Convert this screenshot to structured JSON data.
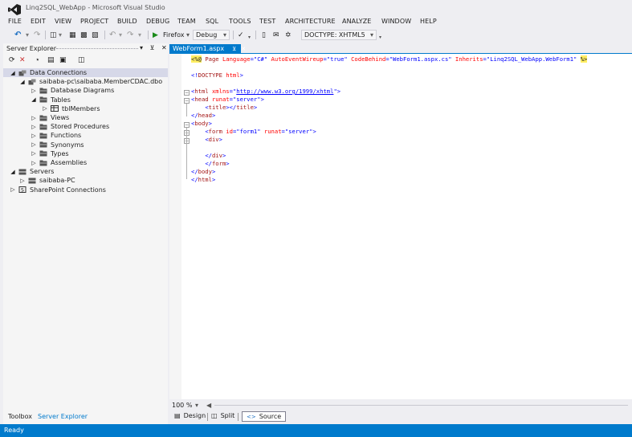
{
  "window": {
    "title": "Linq2SQL_WebApp - Microsoft Visual Studio"
  },
  "menu": [
    "FILE",
    "EDIT",
    "VIEW",
    "PROJECT",
    "BUILD",
    "DEBUG",
    "TEAM",
    "SQL",
    "TOOLS",
    "TEST",
    "ARCHITECTURE",
    "ANALYZE",
    "WINDOW",
    "HELP"
  ],
  "toolbar": {
    "run_target": "Firefox",
    "configuration": "Debug",
    "doctype": "DOCTYPE: XHTML5"
  },
  "server_explorer": {
    "title": "Server Explorer",
    "tree": [
      {
        "label": "Data Connections",
        "level": 0,
        "expanded": true,
        "selected": true,
        "icon": "data-connections-icon"
      },
      {
        "label": "saibaba-pc\\saibaba.MemberCDAC.dbo",
        "level": 1,
        "expanded": true,
        "icon": "db-connection-icon"
      },
      {
        "label": "Database Diagrams",
        "level": 2,
        "expanded": false,
        "icon": "folder-icon"
      },
      {
        "label": "Tables",
        "level": 2,
        "expanded": true,
        "icon": "folder-icon"
      },
      {
        "label": "tblMembers",
        "level": 3,
        "expanded": false,
        "icon": "table-icon"
      },
      {
        "label": "Views",
        "level": 2,
        "expanded": false,
        "icon": "folder-icon"
      },
      {
        "label": "Stored Procedures",
        "level": 2,
        "expanded": false,
        "icon": "folder-icon"
      },
      {
        "label": "Functions",
        "level": 2,
        "expanded": false,
        "icon": "folder-icon"
      },
      {
        "label": "Synonyms",
        "level": 2,
        "expanded": false,
        "icon": "folder-icon"
      },
      {
        "label": "Types",
        "level": 2,
        "expanded": false,
        "icon": "folder-icon"
      },
      {
        "label": "Assemblies",
        "level": 2,
        "expanded": false,
        "icon": "folder-icon"
      },
      {
        "label": "Servers",
        "level": 0,
        "expanded": true,
        "icon": "servers-icon"
      },
      {
        "label": "saibaba-PC",
        "level": 1,
        "expanded": false,
        "icon": "server-icon"
      },
      {
        "label": "SharePoint Connections",
        "level": 0,
        "expanded": false,
        "icon": "sharepoint-icon"
      }
    ]
  },
  "bottom_tabs": {
    "toolbox": "Toolbox",
    "server_explorer": "Server Explorer"
  },
  "editor": {
    "tab_label": "WebForm1.aspx",
    "lines": [
      "<%@ Page Language=\"C#\" AutoEventWireup=\"true\" CodeBehind=\"WebForm1.aspx.cs\" Inherits=\"Linq2SQL_WebApp.WebForm1\" %>",
      "",
      "<!DOCTYPE html>",
      "",
      "<html xmlns=\"http://www.w3.org/1999/xhtml\">",
      "<head runat=\"server\">",
      "    <title></title>",
      "</head>",
      "<body>",
      "    <form id=\"form1\" runat=\"server\">",
      "    <div>",
      "",
      "    </div>",
      "    </form>",
      "</body>",
      "</html>"
    ],
    "zoom": "100 %"
  },
  "view_buttons": {
    "design": "Design",
    "split": "Split",
    "source": "Source"
  },
  "status": "Ready",
  "colors": {
    "accent": "#007acc",
    "keyword": "#0000ff",
    "element": "#a31515",
    "attribute": "#ff0000",
    "highlight": "#ffee62"
  }
}
